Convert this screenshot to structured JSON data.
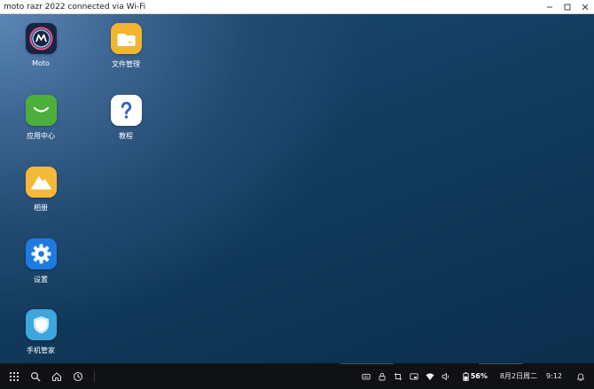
{
  "window": {
    "title": "moto razr 2022 connected via Wi-Fi"
  },
  "apps": [
    {
      "id": "moto",
      "label": "Moto",
      "icon": "moto-logo-icon",
      "color": "#1a2340"
    },
    {
      "id": "files",
      "label": "文件管理",
      "icon": "folder-icon",
      "color": "#f3b531"
    },
    {
      "id": "appstore",
      "label": "应用中心",
      "icon": "shopping-bag-icon",
      "color": "#4caf3c"
    },
    {
      "id": "tutorial",
      "label": "教程",
      "icon": "question-mark-icon",
      "color": "#ffffff"
    },
    {
      "id": "gallery",
      "label": "相册",
      "icon": "mountain-icon",
      "color": "#f5b93a"
    },
    {
      "id": "settings",
      "label": "设置",
      "icon": "gear-icon",
      "color": "#1d7be0"
    },
    {
      "id": "security",
      "label": "手机管家",
      "icon": "shield-icon",
      "color": "#3ea6dc"
    }
  ],
  "taskbar": {
    "battery_percent": "56%",
    "date": "8月2日周二",
    "time": "9:12"
  }
}
